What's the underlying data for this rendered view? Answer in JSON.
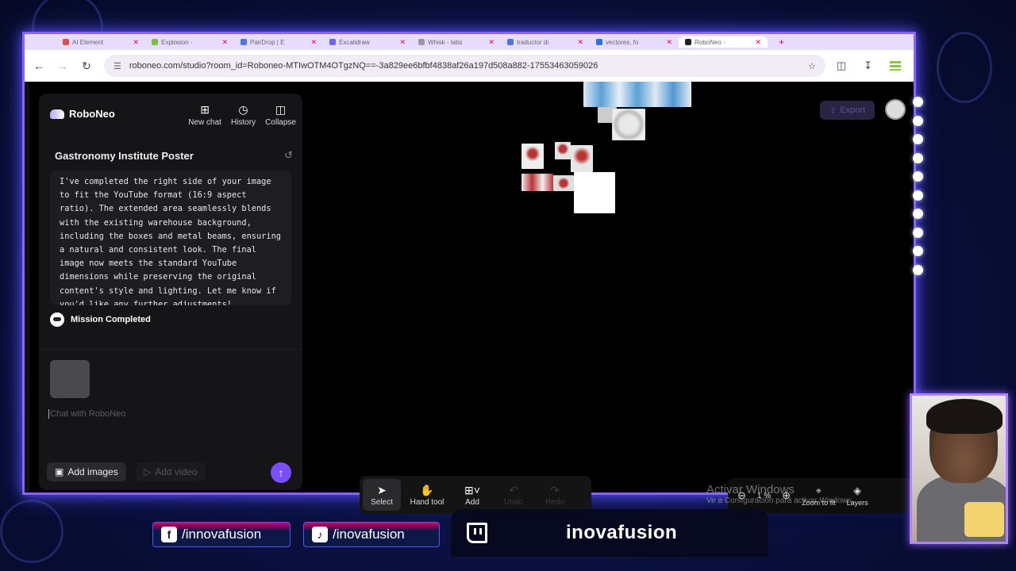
{
  "browser": {
    "tabs": [
      {
        "label": "AI Element",
        "color": "#e04c4c"
      },
      {
        "label": "Explosion -",
        "color": "#7bc043"
      },
      {
        "label": "PairDrop | E",
        "color": "#4a76e0"
      },
      {
        "label": "Excalidraw",
        "color": "#6c63ff"
      },
      {
        "label": "Whisk - labs",
        "color": "#999999"
      },
      {
        "label": "traductor di",
        "color": "#4a76e0"
      },
      {
        "label": "vectores, fo",
        "color": "#2f6fe0"
      },
      {
        "label": "RoboNeo -",
        "color": "#222222"
      }
    ],
    "url": "roboneo.com/studio?room_id=Roboneo-MTIwOTM4OTgzNQ==-3a829ee6bfbf4838af26a197d508a882-17553463059026"
  },
  "app": {
    "name": "RoboNeo",
    "actions": {
      "new_chat": "New chat",
      "history": "History",
      "collapse": "Collapse"
    },
    "project_title": "Gastronomy Institute Poster",
    "message": "I've completed the right side of your image to fit the YouTube format (16:9 aspect ratio). The extended area seamlessly blends with the existing warehouse background, including the boxes and metal beams, ensuring a natural and consistent look. The final image now meets the standard YouTube dimensions while preserving the original content's style and lighting. Let me know if you'd like any further adjustments!",
    "status": "Mission Completed",
    "chat_placeholder": "Chat with RoboNeo",
    "add_images": "Add images",
    "add_video": "Add video",
    "export": "Export"
  },
  "toolbar": {
    "select": "Select",
    "hand": "Hand tool",
    "add": "Add",
    "undo": "Undo",
    "redo": "Redo"
  },
  "zoom": {
    "value": "1",
    "unit": "%",
    "fit": "Zoom to fit",
    "layers": "Layers"
  },
  "watermark": {
    "line1": "Activar Windows",
    "line2": "Ve a Configuración para activar Windows."
  },
  "social": {
    "facebook": "/innovafusion",
    "tiktok": "/inovafusion",
    "twitch": "inovafusion"
  }
}
